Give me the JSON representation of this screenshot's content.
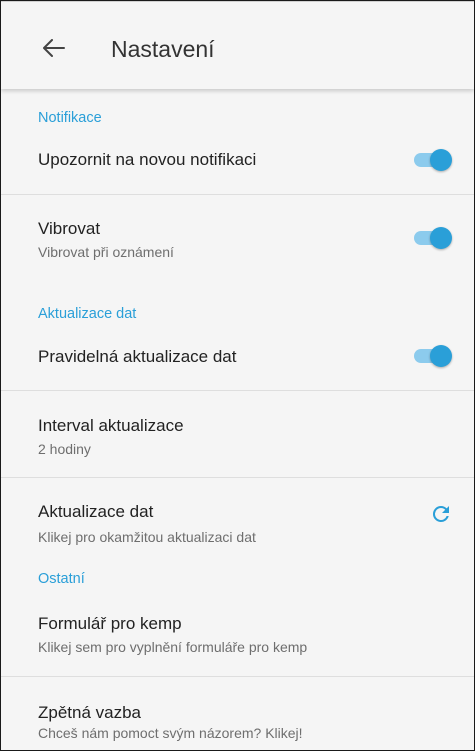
{
  "header": {
    "title": "Nastavení",
    "back_icon": "arrow-left-icon"
  },
  "sections": {
    "notifications": {
      "title": "Notifikace",
      "notify_new": {
        "label": "Upozornit na novou notifikaci",
        "enabled": true
      },
      "vibrate": {
        "label": "Vibrovat",
        "subtitle": "Vibrovat při oznámení",
        "enabled": true
      }
    },
    "data_update": {
      "title": "Aktualizace dat",
      "periodic": {
        "label": "Pravidelná aktualizace dat",
        "enabled": true
      },
      "interval": {
        "label": "Interval aktualizace",
        "subtitle": "2 hodiny"
      },
      "update_now": {
        "label": "Aktualizace dat",
        "subtitle": "Klikej pro okamžitou aktualizaci dat",
        "icon": "refresh-icon"
      }
    },
    "other": {
      "title": "Ostatní",
      "camp_form": {
        "label": "Formulář pro kemp",
        "subtitle": "Klikej sem pro vyplnění formuláře pro kemp"
      },
      "feedback": {
        "label": "Zpětná vazba",
        "subtitle": "Chceš nám pomoct svým názorem? Klikej!"
      }
    }
  },
  "colors": {
    "accent": "#2a9fd8",
    "accent_light": "#8ccbed",
    "background": "#f5f5f5"
  }
}
